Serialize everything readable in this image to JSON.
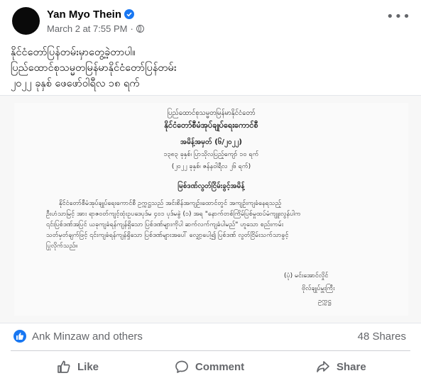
{
  "post": {
    "author": "Yan Myo Thein",
    "timestamp": "March 2 at 7:55 PM",
    "separator": "·",
    "privacy_icon": "globe-icon",
    "more_icon": "more-horizontal-icon",
    "text_lines": [
      "နိုင်ငံတော်ပြန်တမ်းမှာတွေ့ခဲ့တာပါ။",
      "ပြည်ထောင်စုသမ္မတမြန်မာနိုင်ငံတော်ပြန်တမ်း",
      "၂၀၂၂ ခုနှစ် ဖေဖော်ဝါရီလ ၁၈ ရက်"
    ]
  },
  "document": {
    "header_line": "ပြည်ထောင်စုသမ္မတမြန်မာနိုင်ငံတော်",
    "council": "နိုင်ငံတော်စီမံအုပ်ချုပ်ရေးကောင်စီ",
    "order_no": "အမိန့်အမှတ် (၆/၂၀၂၂)",
    "date_mm": "၁၃၈၃ ခုနှစ်၊ ပြာသိုလပြည့်ကျော် ၁၀ ရက်",
    "date_en": "(၂၀၂၂ ခုနှစ်၊ ဇန်နဝါရီလ ၂၆ ရက်)",
    "subject": "မြစ်ဒဏ်လွတ်ငြိမ်းခွင့်အမိန့်",
    "paragraph": [
      "နိုင်ငံတော်စီမံအုပ်ချုပ်ရေးကောင်စီ ဥက္ကဋ္ဌသည် အင်းစိန်အကျဉ်းထောင်တွင် အကျဉ်းကျခံနေရသည့်",
      "ဦးဟံသာမြင့် အား ရာဇဝတ်ကျင့်ထုံးဥပဒေပုဒ်မ ၄၀၁ ပုဒ်မခွဲ (၁) အရ \"နောက်တစ်ကြိမ်ပြစ်မှုထပ်မံကျူးလွန်ပါက",
      "၎င်းပြစ်ဒဏ်အပြင် ယခုကျခံရန်ကျန်ရှိသော ပြစ်ဒဏ်များကိုပါ ဆက်လက်ကျခံပါမည်\" ဟူသော စည်းကမ်း",
      "သတ်မှတ်ချက်ဖြင့် ၎င်းကျခံရန်ကျန်ရှိသော ပြစ်ဒဏ်များအပေါ် လျှော့ပေါ့၍ ပြစ်ဒဏ် လွတ်ငြိမ်းသက်သာခွင့်",
      "ပြုလိုက်သည်။"
    ],
    "signature_name": "(ပုံ) မင်းအောင်လှိုင်",
    "signature_title": "ဗိုလ်ချုပ်မှူးကြီး",
    "signature_role": "ဥက္ကဋ္ဌ"
  },
  "stats": {
    "reaction_icon": "like-reaction-icon",
    "reactors": "Ank Minzaw and others",
    "shares": "48 Shares"
  },
  "actions": {
    "like": "Like",
    "comment": "Comment",
    "share": "Share"
  },
  "colors": {
    "brand_blue": "#1877f2",
    "secondary_text": "#65676b",
    "primary_text": "#050505"
  }
}
